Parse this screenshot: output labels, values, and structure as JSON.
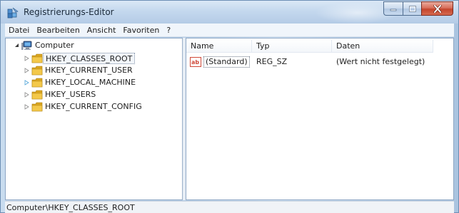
{
  "window": {
    "title": "Registrierungs-Editor",
    "colors": {
      "accent": "#3a6ea5",
      "close": "#c4452c",
      "folder": "#e8b83a"
    }
  },
  "menu": {
    "items": [
      "Datei",
      "Bearbeiten",
      "Ansicht",
      "Favoriten",
      "?"
    ]
  },
  "tree": {
    "root": {
      "label": "Computer",
      "icon": "computer-icon"
    },
    "items": [
      {
        "label": "HKEY_CLASSES_ROOT",
        "icon": "folder-icon",
        "selected": true
      },
      {
        "label": "HKEY_CURRENT_USER",
        "icon": "folder-icon"
      },
      {
        "label": "HKEY_LOCAL_MACHINE",
        "icon": "folder-icon"
      },
      {
        "label": "HKEY_USERS",
        "icon": "folder-icon"
      },
      {
        "label": "HKEY_CURRENT_CONFIG",
        "icon": "folder-icon"
      }
    ]
  },
  "list": {
    "columns": [
      "Name",
      "Typ",
      "Daten"
    ],
    "rows": [
      {
        "name": "(Standard)",
        "type": "REG_SZ",
        "data": "(Wert nicht festgelegt)",
        "icon": "string-value-icon"
      }
    ]
  },
  "status": {
    "path": "Computer\\HKEY_CLASSES_ROOT"
  }
}
